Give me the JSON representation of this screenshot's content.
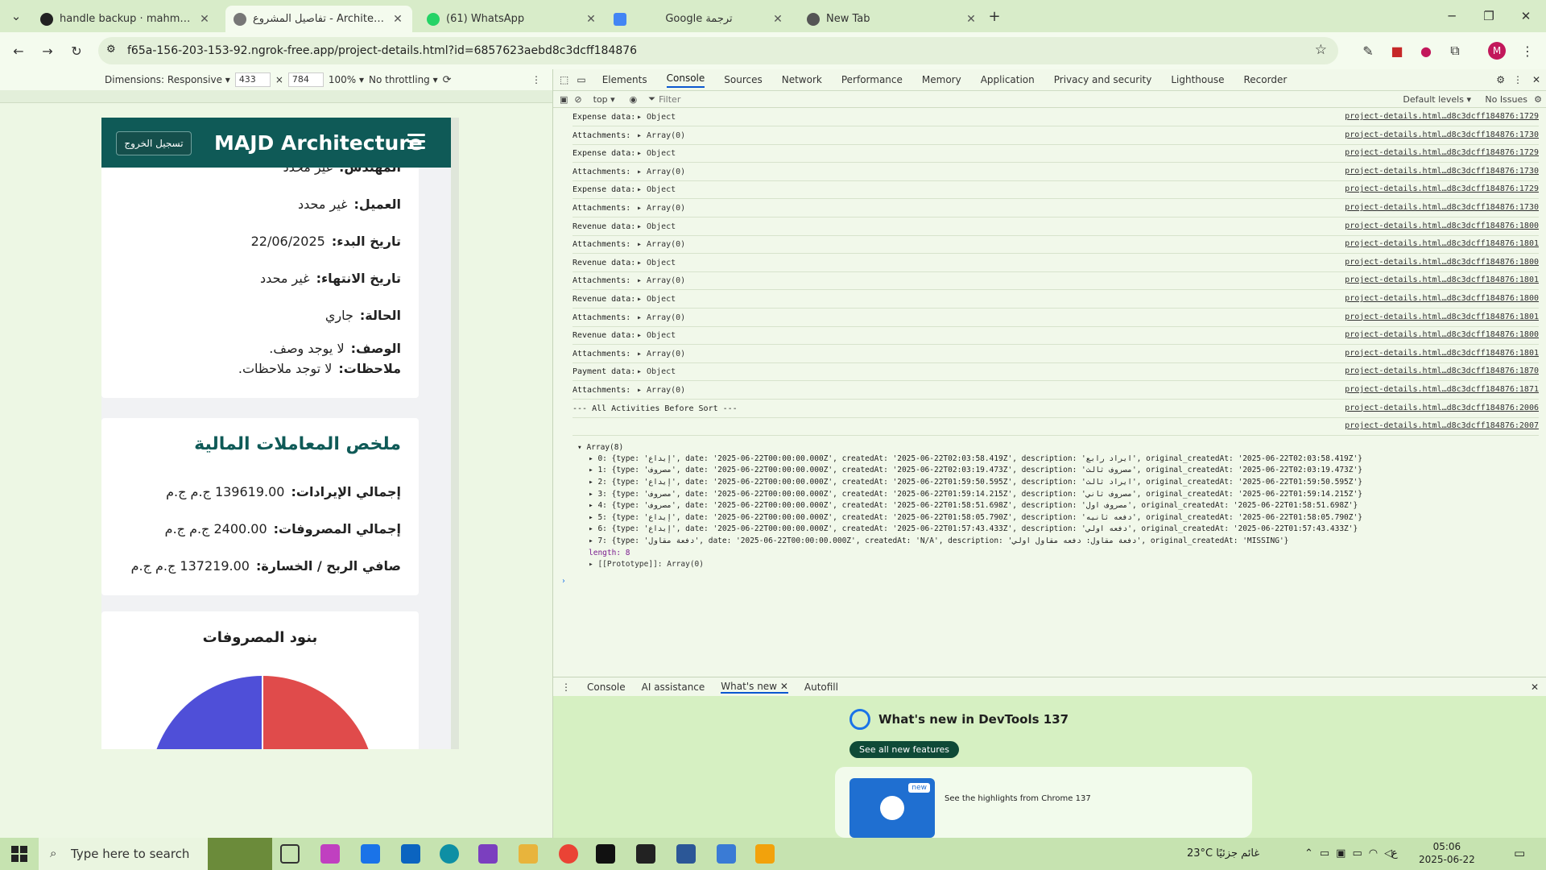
{
  "browser": {
    "tabs": [
      {
        "title": "handle backup · mahmoud556...",
        "active": false
      },
      {
        "title": "تفاصيل المشروع - Architecture",
        "active": true
      },
      {
        "title": "(61) WhatsApp",
        "active": false
      },
      {
        "title": "Google ترجمة",
        "active": false
      },
      {
        "title": "New Tab",
        "active": false
      }
    ],
    "url": "f65a-156-203-153-92.ngrok-free.app/project-details.html?id=6857623aebd8c3dcff184876",
    "profile_initial": "M"
  },
  "device_toolbar": {
    "dimensions_label": "Dimensions: Responsive ▾",
    "width": "433",
    "x": "×",
    "height": "784",
    "zoom": "100% ▾",
    "throttle": "No throttling ▾"
  },
  "app": {
    "brand": "MAJD Architecture",
    "logout": "تسجيل الخروج",
    "details": [
      {
        "label": "المهندس:",
        "value": "غير محدد"
      },
      {
        "label": "العميل:",
        "value": "غير محدد"
      },
      {
        "label": "تاريخ البدء:",
        "value": "22/06/2025"
      },
      {
        "label": "تاريخ الانتهاء:",
        "value": "غير محدد"
      },
      {
        "label": "الحالة:",
        "value": "جاري"
      },
      {
        "label": "الوصف:",
        "value": "لا يوجد وصف."
      },
      {
        "label": "ملاحظات:",
        "value": "لا توجد ملاحظات."
      }
    ],
    "summary_title": "ملخص المعاملات المالية",
    "summary": [
      {
        "label": "إجمالي الإيرادات:",
        "value": "139619.00 ج.م ج.م"
      },
      {
        "label": "إجمالي المصروفات:",
        "value": "2400.00 ج.م ج.م"
      },
      {
        "label": "صافي الربح / الخسارة:",
        "value": "137219.00 ج.م ج.م"
      }
    ],
    "chart_title": "بنود المصروفات",
    "chart_colors": [
      "#4f4fd8",
      "#e04b4b"
    ]
  },
  "devtools": {
    "tabs": [
      "Elements",
      "Console",
      "Sources",
      "Network",
      "Performance",
      "Memory",
      "Application",
      "Privacy and security",
      "Lighthouse",
      "Recorder"
    ],
    "context": "top ▾",
    "filter_placeholder": "Filter",
    "levels": "Default levels ▾",
    "issues": "No Issues",
    "log": [
      {
        "msg": "Expense data:",
        "val": "▸ Object",
        "src": "project-details.html…d8c3dcff184876:1729"
      },
      {
        "msg": "Attachments:",
        "val": "▸ Array(0)",
        "src": "project-details.html…d8c3dcff184876:1730"
      },
      {
        "msg": "Expense data:",
        "val": "▸ Object",
        "src": "project-details.html…d8c3dcff184876:1729"
      },
      {
        "msg": "Attachments:",
        "val": "▸ Array(0)",
        "src": "project-details.html…d8c3dcff184876:1730"
      },
      {
        "msg": "Expense data:",
        "val": "▸ Object",
        "src": "project-details.html…d8c3dcff184876:1729"
      },
      {
        "msg": "Attachments:",
        "val": "▸ Array(0)",
        "src": "project-details.html…d8c3dcff184876:1730"
      },
      {
        "msg": "Revenue data:",
        "val": "▸ Object",
        "src": "project-details.html…d8c3dcff184876:1800"
      },
      {
        "msg": "Attachments:",
        "val": "▸ Array(0)",
        "src": "project-details.html…d8c3dcff184876:1801"
      },
      {
        "msg": "Revenue data:",
        "val": "▸ Object",
        "src": "project-details.html…d8c3dcff184876:1800"
      },
      {
        "msg": "Attachments:",
        "val": "▸ Array(0)",
        "src": "project-details.html…d8c3dcff184876:1801"
      },
      {
        "msg": "Revenue data:",
        "val": "▸ Object",
        "src": "project-details.html…d8c3dcff184876:1800"
      },
      {
        "msg": "Attachments:",
        "val": "▸ Array(0)",
        "src": "project-details.html…d8c3dcff184876:1801"
      },
      {
        "msg": "Revenue data:",
        "val": "▸ Object",
        "src": "project-details.html…d8c3dcff184876:1800"
      },
      {
        "msg": "Attachments:",
        "val": "▸ Array(0)",
        "src": "project-details.html…d8c3dcff184876:1801"
      },
      {
        "msg": "Payment data:",
        "val": "▸ Object",
        "src": "project-details.html…d8c3dcff184876:1870"
      },
      {
        "msg": "Attachments:",
        "val": "▸ Array(0)",
        "src": "project-details.html…d8c3dcff184876:1871"
      },
      {
        "msg": "--- All Activities Before Sort ---",
        "val": "",
        "src": "project-details.html…d8c3dcff184876:2006"
      },
      {
        "msg": "",
        "val": "",
        "src": "project-details.html…d8c3dcff184876:2007"
      }
    ],
    "array_header": "▾ Array(8)",
    "array_items": [
      "▸ 0: {type: 'إيداع', date: '2025-06-22T00:00:00.000Z', createdAt: '2025-06-22T02:03:58.419Z', description: 'ايراد رابع', original_createdAt: '2025-06-22T02:03:58.419Z'}",
      "▸ 1: {type: 'مصروف', date: '2025-06-22T00:00:00.000Z', createdAt: '2025-06-22T02:03:19.473Z', description: 'مصروف ثالث', original_createdAt: '2025-06-22T02:03:19.473Z'}",
      "▸ 2: {type: 'إيداع', date: '2025-06-22T00:00:00.000Z', createdAt: '2025-06-22T01:59:50.595Z', description: 'ايراد ثالث', original_createdAt: '2025-06-22T01:59:50.595Z'}",
      "▸ 3: {type: 'مصروف', date: '2025-06-22T00:00:00.000Z', createdAt: '2025-06-22T01:59:14.215Z', description: 'مصروف ثاني', original_createdAt: '2025-06-22T01:59:14.215Z'}",
      "▸ 4: {type: 'مصروف', date: '2025-06-22T00:00:00.000Z', createdAt: '2025-06-22T01:58:51.698Z', description: 'مصروف اول', original_createdAt: '2025-06-22T01:58:51.698Z'}",
      "▸ 5: {type: 'إيداع', date: '2025-06-22T00:00:00.000Z', createdAt: '2025-06-22T01:58:05.790Z', description: 'دفعه ثانيه', original_createdAt: '2025-06-22T01:58:05.790Z'}",
      "▸ 6: {type: 'إيداع', date: '2025-06-22T00:00:00.000Z', createdAt: '2025-06-22T01:57:43.433Z', description: 'دفعه اولي', original_createdAt: '2025-06-22T01:57:43.433Z'}",
      "▸ 7: {type: 'دفعة مقاول', date: '2025-06-22T00:00:00.000Z', createdAt: 'N/A', description: 'دفعة مقاول: دفعه مقاول اولي', original_createdAt: 'MISSING'}"
    ],
    "array_length": "length: 8",
    "array_proto": "▸ [[Prototype]]: Array(0)",
    "drawer_tabs": [
      "Console",
      "AI assistance",
      "What's new",
      "Autofill"
    ],
    "whats_new_title": "What's new in DevTools 137",
    "see_all": "See all new features",
    "highlights": "See the highlights from Chrome 137",
    "new_badge": "new"
  },
  "taskbar": {
    "search_placeholder": "Type here to search",
    "weather": "23°C  غائم جزئيًا",
    "lang": "ع",
    "time": "05:06",
    "date": "2025-06-22"
  }
}
